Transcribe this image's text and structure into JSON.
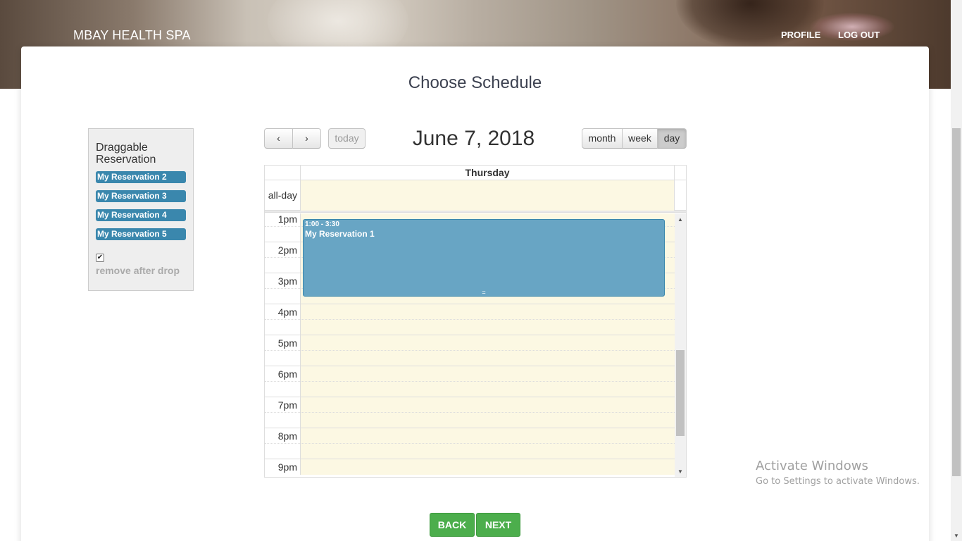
{
  "header": {
    "brand": "MBAY HEALTH SPA",
    "nav": [
      {
        "label": "PROFILE"
      },
      {
        "label": "LOG OUT"
      }
    ]
  },
  "main": {
    "title": "Choose Schedule"
  },
  "draggable": {
    "heading": "Draggable Reservation",
    "items": [
      {
        "label": "My Reservation 2"
      },
      {
        "label": "My Reservation 3"
      },
      {
        "label": "My Reservation 4"
      },
      {
        "label": "My Reservation 5"
      }
    ],
    "remove_after_drop": {
      "label": "remove after drop",
      "checked": true
    }
  },
  "calendar": {
    "toolbar": {
      "prev_glyph": "‹",
      "next_glyph": "›",
      "today_label": "today",
      "views": [
        {
          "label": "month",
          "active": false
        },
        {
          "label": "week",
          "active": false
        },
        {
          "label": "day",
          "active": true
        }
      ]
    },
    "date_title": "June 7, 2018",
    "day_header": "Thursday",
    "all_day_label": "all-day",
    "time_labels": [
      "1pm",
      "2pm",
      "3pm",
      "4pm",
      "5pm",
      "6pm",
      "7pm",
      "8pm",
      "9pm"
    ],
    "event": {
      "time": "1:00 - 3:30",
      "title": "My Reservation 1",
      "resize_glyph": "="
    },
    "colors": {
      "event_bg": "#68a5c4",
      "event_border": "#3a87ad",
      "today_bg": "#fcf8e3"
    }
  },
  "footer": {
    "back_label": "BACK",
    "next_label": "NEXT"
  },
  "watermark": {
    "line1": "Activate Windows",
    "line2": "Go to Settings to activate Windows."
  }
}
